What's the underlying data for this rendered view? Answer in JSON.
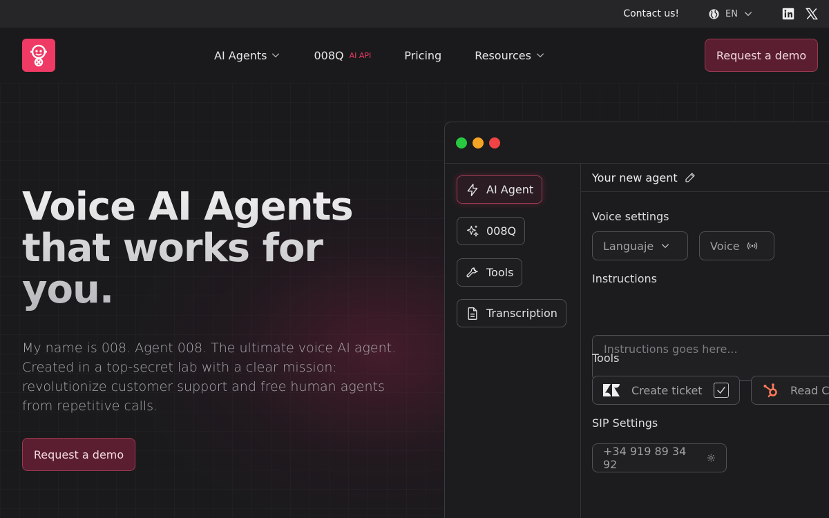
{
  "topbar": {
    "contact": "Contact us!",
    "language": "EN"
  },
  "nav": {
    "menu": [
      {
        "label": "AI Agents"
      },
      {
        "label": "008Q",
        "tag": "AI API"
      },
      {
        "label": "Pricing"
      },
      {
        "label": "Resources"
      }
    ],
    "cta": "Request a demo"
  },
  "hero": {
    "title_lines": [
      "Voice AI Agents",
      "that works for",
      "you."
    ],
    "description": "My name is 008. Agent 008. The ultimate voice AI agent. Created in a top-secret lab with a clear mission: revolutionize customer support and free human agents from repetitive calls.",
    "cta": "Request a demo"
  },
  "app": {
    "sidebar": [
      {
        "label": "AI Agent"
      },
      {
        "label": "008Q"
      },
      {
        "label": "Tools"
      },
      {
        "label": "Transcription"
      }
    ],
    "agent_name": "Your new agent",
    "voice_settings": {
      "label": "Voice settings",
      "language": "Languaje",
      "voice": "Voice"
    },
    "instructions": {
      "label": "Instructions",
      "placeholder": "Instructions goes here..."
    },
    "tools": {
      "label": "Tools",
      "items": [
        "Create ticket",
        "Read C"
      ]
    },
    "sip": {
      "label": "SIP Settings",
      "phone": "+34 919 89 34 92"
    }
  },
  "colors": {
    "accent": "#ee3a64",
    "button_bg": "#5a1e30",
    "dot_green": "#28c840",
    "dot_yellow": "#f5a524",
    "dot_red": "#ef4444",
    "hubspot": "#ff7a59"
  }
}
